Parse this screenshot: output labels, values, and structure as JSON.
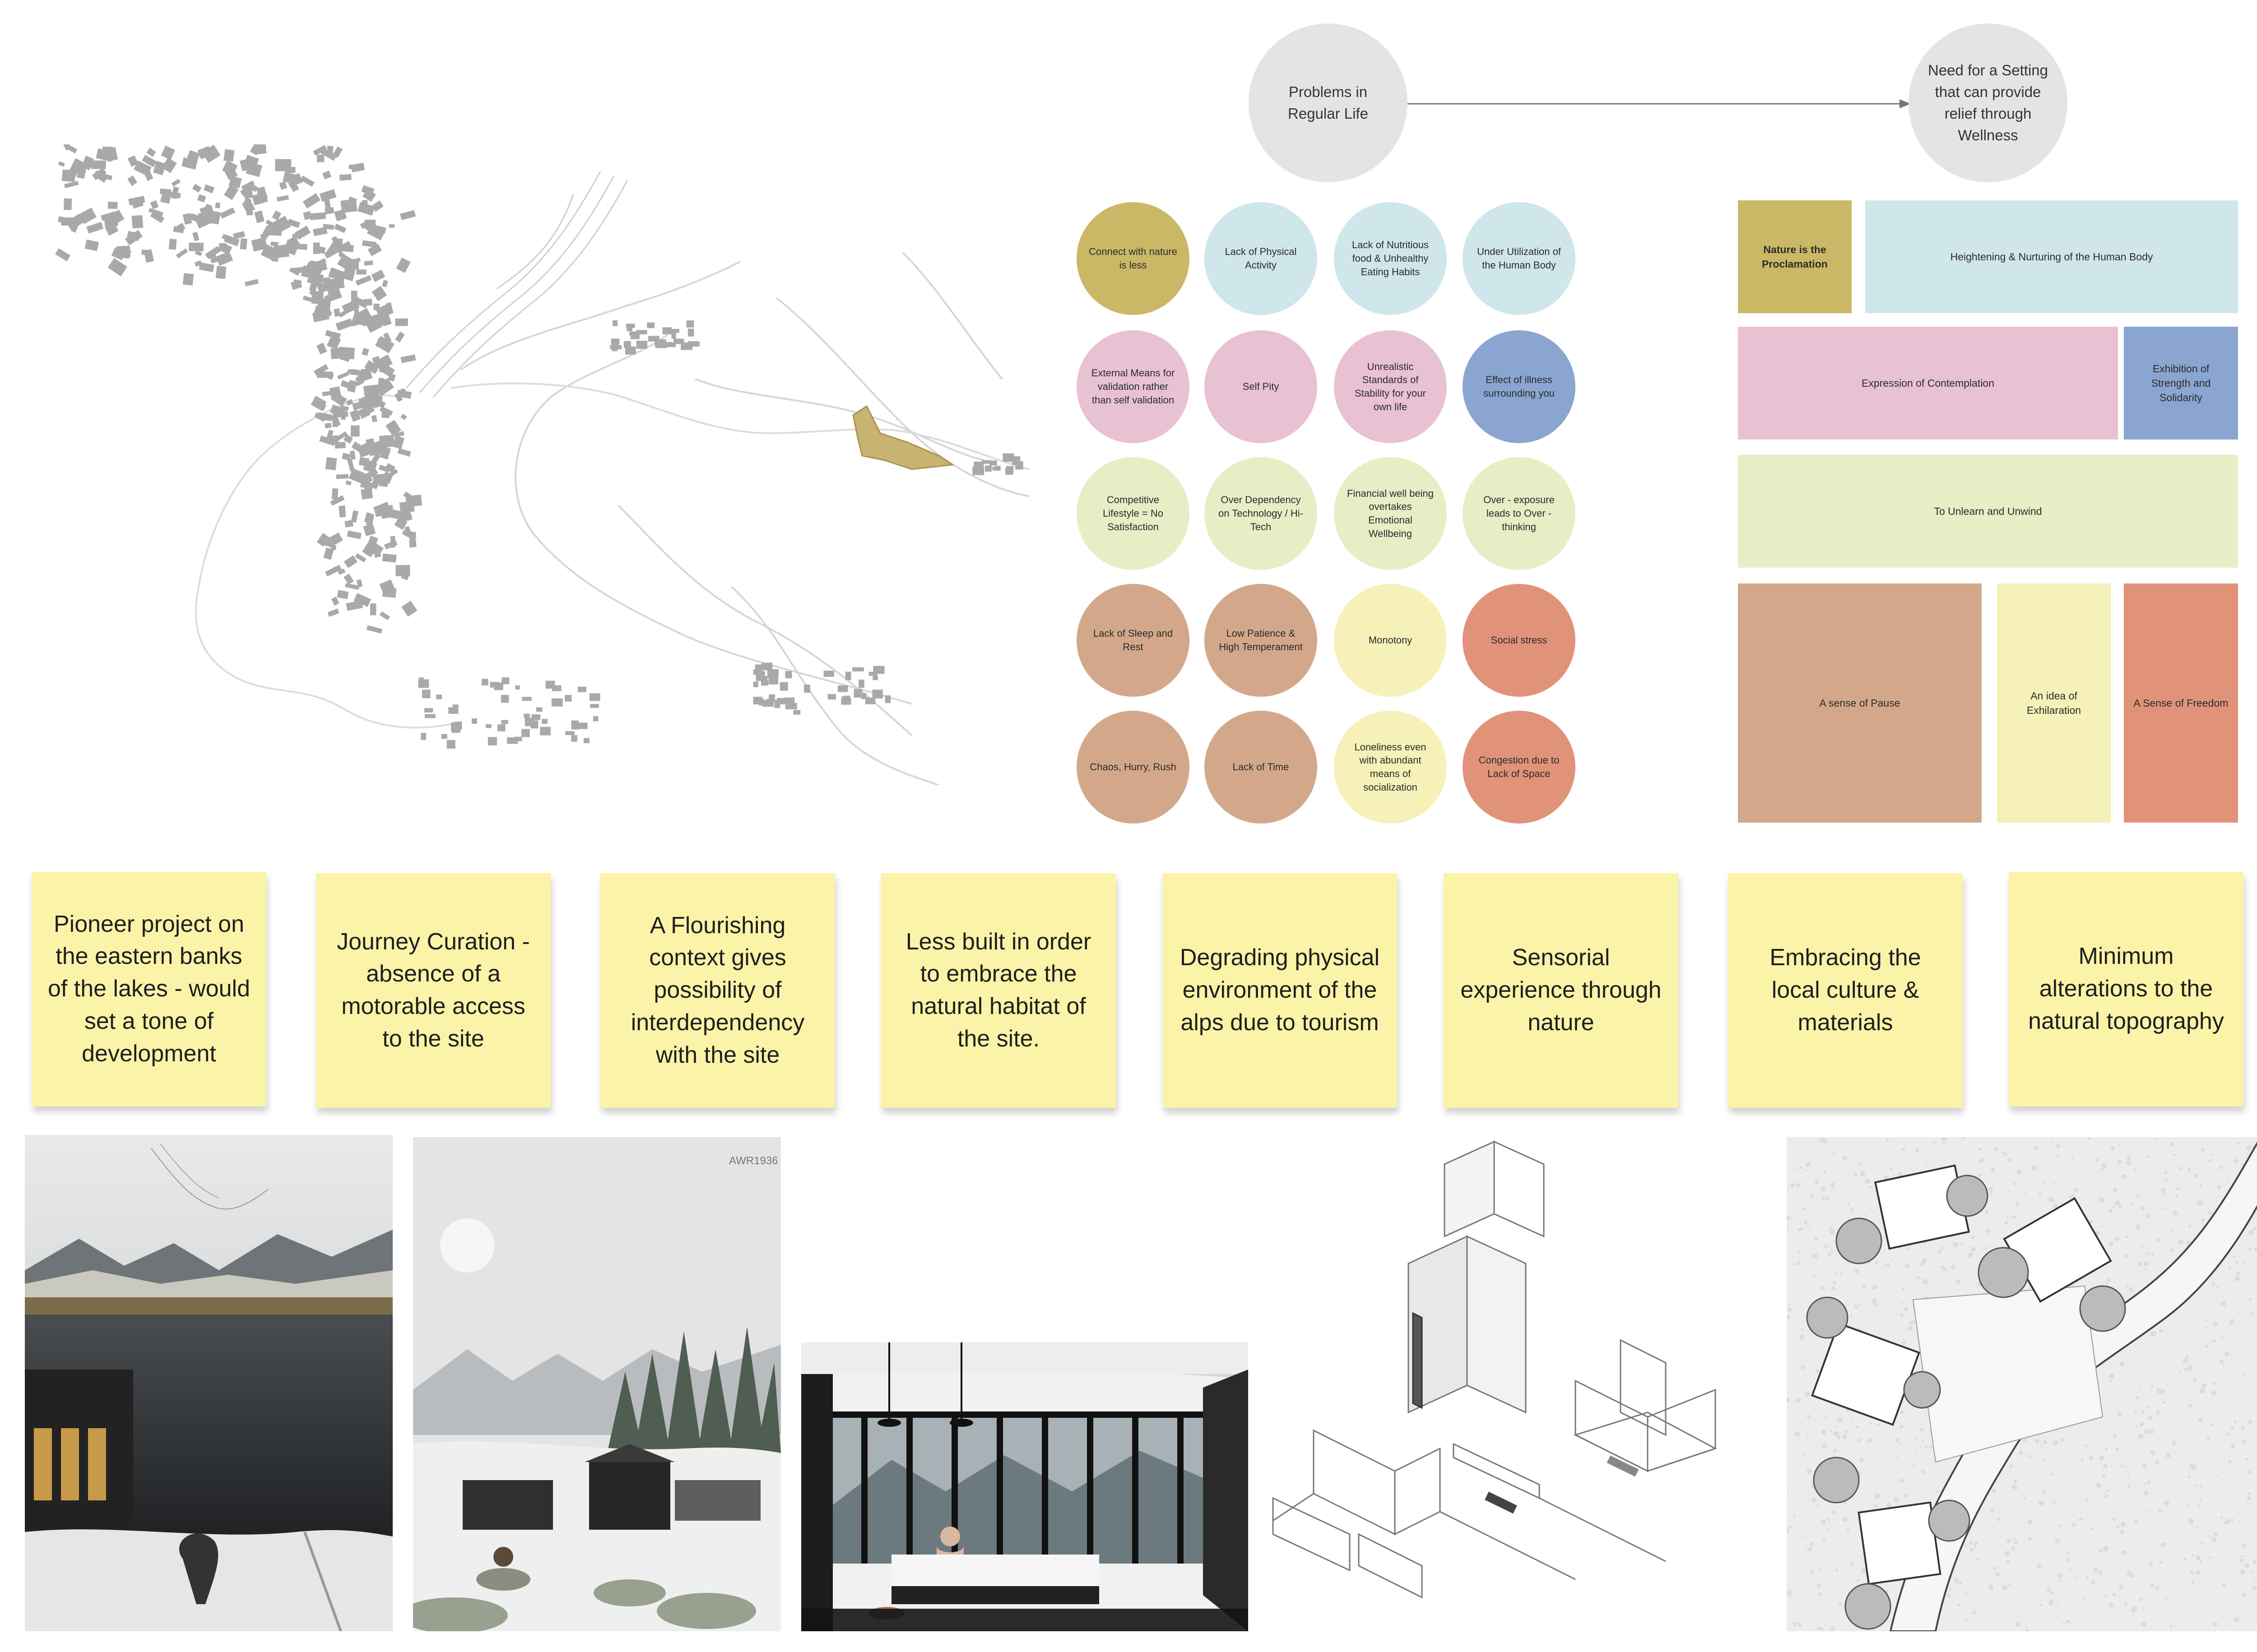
{
  "colors": {
    "mustard": "#cbb866",
    "light_blue": "#cfe7ea",
    "pink": "#e8c2d2",
    "blue": "#8aa5d0",
    "light_green": "#e6eec6",
    "tan": "#d3a88a",
    "pale_yellow": "#f5f1b8",
    "coral": "#e1937a",
    "header_grey": "#e4e4e4",
    "sticky": "#fbf3a8"
  },
  "flow": {
    "left": "Problems in Regular Life",
    "right": "Need for a Setting that can provide relief through Wellness"
  },
  "problems": [
    [
      "Connect with nature is less",
      "Lack of Physical Activity",
      "Lack of Nutritious food & Unhealthy Eating Habits",
      "Under Utilization of the Human Body"
    ],
    [
      "External Means for validation rather than self validation",
      "Self Pity",
      "Unrealistic Standards of Stability for your own life",
      "Effect of illness surrounding you"
    ],
    [
      "Competitive Lifestyle = No Satisfaction",
      "Over Dependency on Technology / Hi-Tech",
      "Financial well being overtakes Emotional Wellbeing",
      "Over - exposure leads to Over - thinking"
    ],
    [
      "Lack of Sleep and Rest",
      "Low Patience & High Temperament",
      "Monotony",
      "Social stress"
    ],
    [
      "Chaos, Hurry, Rush",
      "Lack of Time",
      "Loneliness even with abundant means of socialization",
      "Congestion due to Lack of Space"
    ]
  ],
  "needs": {
    "nature": "Nature is the Proclamation",
    "heightening": "Heightening & Nurturing of the Human Body",
    "contemplation": "Expression of Contemplation",
    "strength": "Exhibition of Strength and Solidarity",
    "unlearn": "To Unlearn and Unwind",
    "pause": "A sense of Pause",
    "exhilaration": "An idea of Exhilaration",
    "freedom": "A Sense of Freedom"
  },
  "notes": [
    "Pioneer project on the eastern banks of the lakes - would set a tone of development",
    "Journey Curation - absence of a motorable access to the site",
    "A Flourishing context gives possibility of interdependency with the site",
    "Less built in order to embrace the natural habitat of the site.",
    "Degrading physical environment of the alps due to tourism",
    "Sensorial experience through nature",
    "Embracing the local culture & materials",
    "Minimum alterations to the natural topography"
  ],
  "render_label": "AWR1936"
}
